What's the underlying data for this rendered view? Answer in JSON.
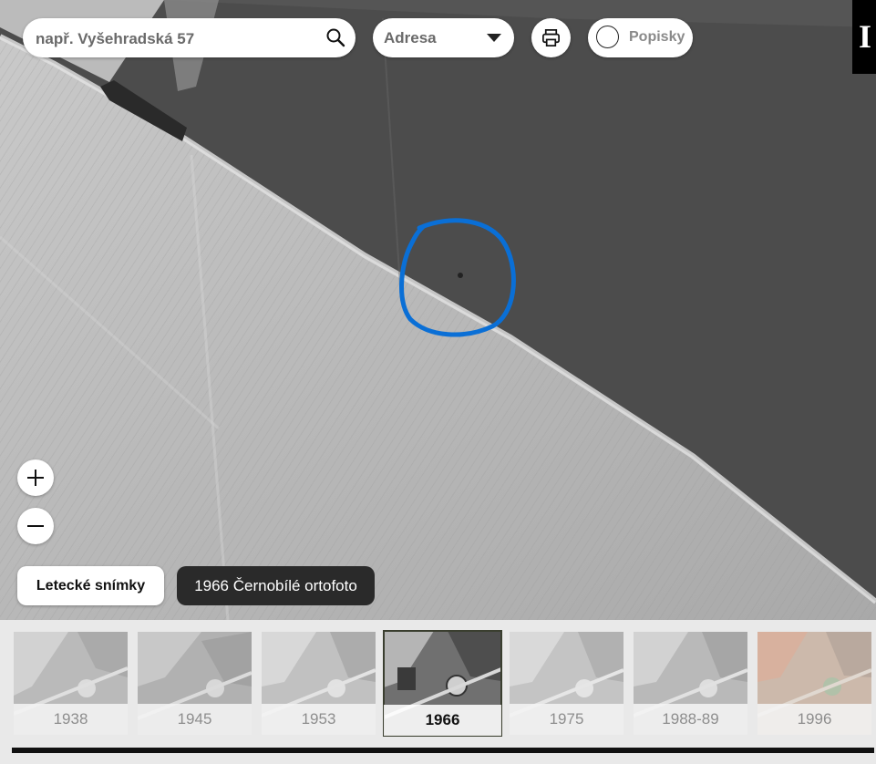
{
  "search": {
    "placeholder": "např. Vyšehradská 57"
  },
  "search_type": {
    "selected": "Adresa"
  },
  "labels_toggle": {
    "label": "Popisky"
  },
  "info_button": {
    "label": "I"
  },
  "layer": {
    "button_label": "Letecké snímky",
    "current": "1966 Černobílé ortofoto"
  },
  "timeline": {
    "items": [
      {
        "year": "1938",
        "active": false
      },
      {
        "year": "1945",
        "active": false
      },
      {
        "year": "1953",
        "active": false
      },
      {
        "year": "1966",
        "active": true
      },
      {
        "year": "1975",
        "active": false
      },
      {
        "year": "1988-89",
        "active": false
      },
      {
        "year": "1996",
        "active": false
      }
    ]
  },
  "colors": {
    "highlight_circle": "#0a6fd6",
    "active_thumb_border": "#3a3e2f"
  }
}
